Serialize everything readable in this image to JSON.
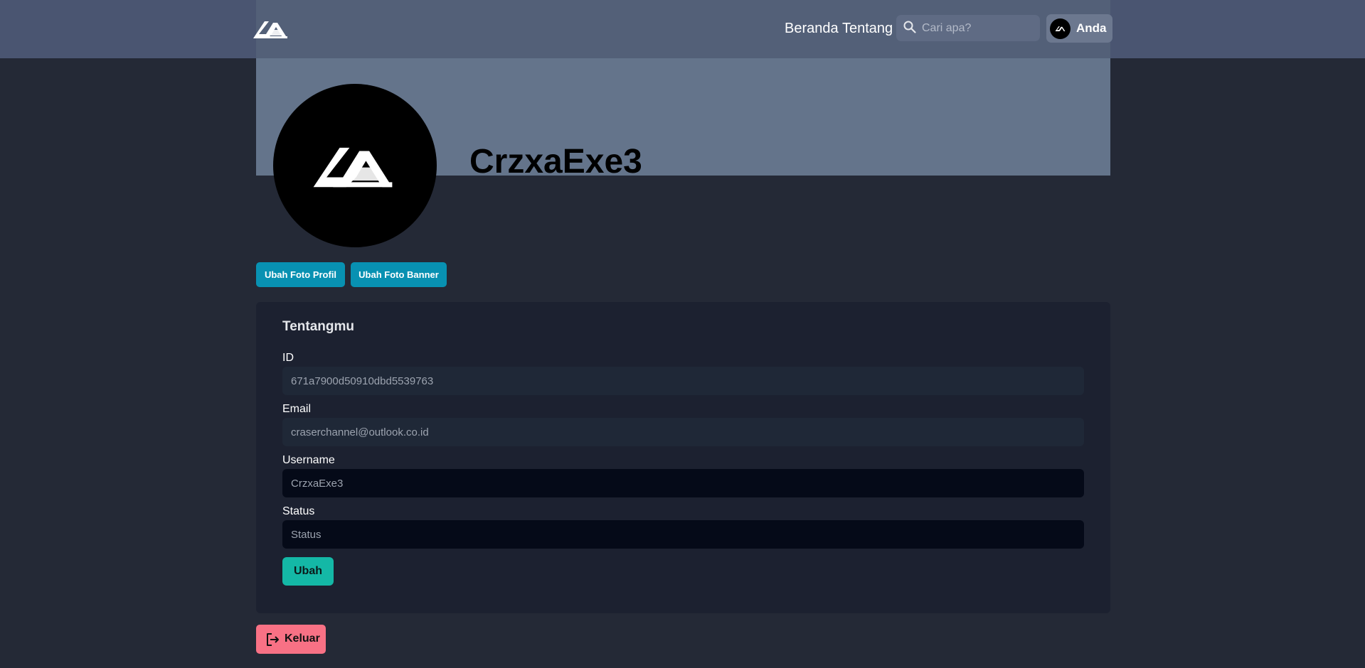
{
  "header": {
    "logo_icon": "brand-logo-icon",
    "nav": [
      {
        "label": "Beranda"
      },
      {
        "label": "Tentang"
      }
    ],
    "search": {
      "placeholder": "Cari apa?",
      "icon": "search-icon"
    },
    "user": {
      "label": "Anda",
      "avatar_icon": "brand-logo-icon"
    }
  },
  "profile": {
    "username": "CrzxaExe3",
    "change_photo_label": "Ubah Foto Profil",
    "change_banner_label": "Ubah Foto Banner"
  },
  "about_card": {
    "title": "Tentangmu",
    "fields": {
      "id": {
        "label": "ID",
        "value": "671a7900d50910dbd5539763"
      },
      "email": {
        "label": "Email",
        "value": "craserchannel@outlook.co.id"
      },
      "username": {
        "label": "Username",
        "value": "CrzxaExe3"
      },
      "status": {
        "label": "Status",
        "value": "",
        "placeholder": "Status"
      }
    },
    "save_label": "Ubah"
  },
  "logout": {
    "label": "Keluar",
    "icon": "logout-icon"
  },
  "colors": {
    "background": "#242936",
    "topbar": "#4a5571",
    "banner": "#64748b",
    "card": "#1c2130",
    "primary_button": "#0891b2",
    "save_button": "#14b8a6",
    "logout_button": "#f87185"
  }
}
